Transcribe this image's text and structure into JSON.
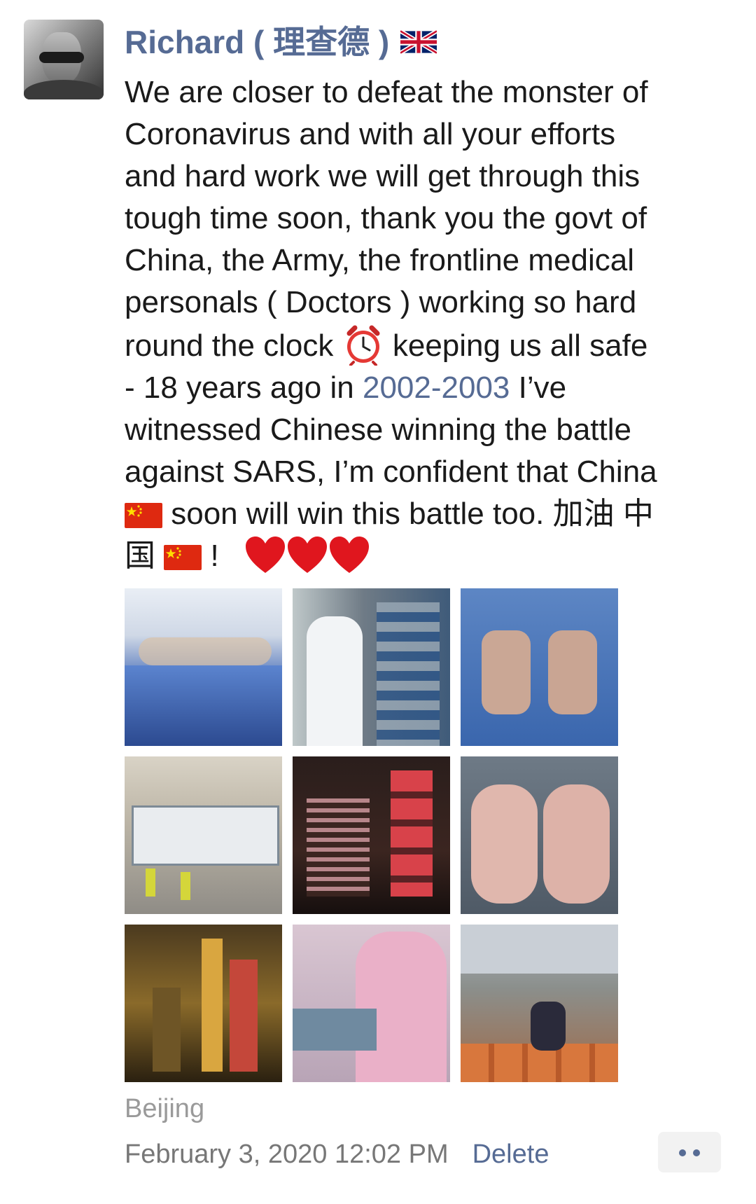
{
  "post": {
    "author_name": "Richard ( 理查德 )",
    "author_flag_icon": "uk-flag-icon",
    "text_lines": [
      "We are closer to defeat the monster of",
      "Coronavirus and with all your efforts",
      "and hard work we will get through this",
      "tough time soon, thank you the govt of",
      "China, the Army, the frontline medical",
      "personals ( Doctors ) working so hard"
    ],
    "line7_before": "round the clock ",
    "line7_after": " keeping us all safe",
    "line8_before": " - 18 years ago in ",
    "line8_link": "2002-2003",
    "line8_after": " I’ve",
    "line9": "witnessed Chinese winning the battle",
    "line10": "against SARS, I’m confident that China",
    "line11_after": " soon will win this battle too. 加油 中",
    "line12_before": "国",
    "line12_mark": " !",
    "images": [
      {
        "name": "photo-officials-in-hospital"
      },
      {
        "name": "photo-worker-disinfecting-train"
      },
      {
        "name": "photo-doctor-hands-gloves"
      },
      {
        "name": "photo-hospital-construction"
      },
      {
        "name": "photo-night-building-slogan"
      },
      {
        "name": "photo-damaged-hands"
      },
      {
        "name": "photo-city-skyline-night"
      },
      {
        "name": "photo-workers-making-masks"
      },
      {
        "name": "photo-worker-resting-construction"
      }
    ],
    "location": "Beijing",
    "timestamp": "February 3, 2020 12:02 PM",
    "delete_label": "Delete"
  },
  "colors": {
    "link": "#566b94",
    "text": "#1a1a1a",
    "muted": "#9a9a9a"
  }
}
